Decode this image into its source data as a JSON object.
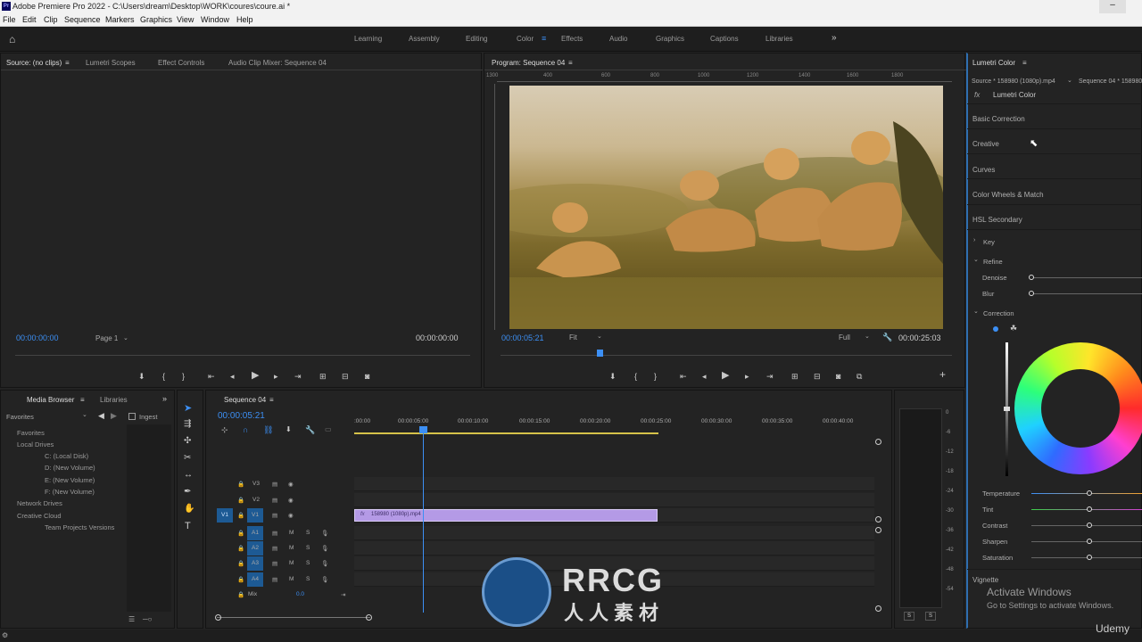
{
  "app": {
    "title": "Adobe Premiere Pro 2022 - C:\\Users\\dream\\Desktop\\WORK\\coures\\coure.ai *",
    "logo": "Pr"
  },
  "menu": [
    "File",
    "Edit",
    "Clip",
    "Sequence",
    "Markers",
    "Graphics",
    "View",
    "Window",
    "Help"
  ],
  "workspaces": [
    "Learning",
    "Assembly",
    "Editing",
    "Color",
    "Effects",
    "Audio",
    "Graphics",
    "Captions",
    "Libraries"
  ],
  "active_workspace": "Color",
  "source_panel": {
    "tabs": [
      "Source: (no clips)",
      "Lumetri Scopes",
      "Effect Controls",
      "Audio Clip Mixer: Sequence 04"
    ],
    "timecode_left": "00:00:00:00",
    "page": "Page 1",
    "timecode_right": "00:00:00:00"
  },
  "program_panel": {
    "title": "Program: Sequence 04",
    "ruler": [
      "1300",
      "400",
      "600",
      "800",
      "1000",
      "1200",
      "1400",
      "1600",
      "1800"
    ],
    "timecode": "00:00:05:21",
    "fit": "Fit",
    "quality": "Full",
    "duration": "00:00:25:03"
  },
  "lumetri": {
    "title": "Lumetri Color",
    "source": "Source * 158980 (1080p).mp4",
    "sequence": "Sequence 04 * 158980",
    "fx": "Lumetri Color",
    "sections": [
      "Basic Correction",
      "Creative",
      "Curves",
      "Color Wheels & Match",
      "HSL Secondary"
    ],
    "key": "Key",
    "refine": "Refine",
    "denoise": "Denoise",
    "blur": "Blur",
    "correction": "Correction",
    "sliders": [
      "Temperature",
      "Tint",
      "Contrast",
      "Sharpen",
      "Saturation"
    ],
    "vignette": "Vignette"
  },
  "media_browser": {
    "tabs": [
      "Media Browser",
      "Libraries"
    ],
    "favorites_dropdown": "Favorites",
    "ingest": "Ingest",
    "tree": [
      "Favorites",
      "Local Drives",
      "C: (Local Disk)",
      "D: (New Volume)",
      "E: (New Volume)",
      "F: (New Volume)",
      "Network Drives",
      "Creative Cloud",
      "Team Projects Versions"
    ]
  },
  "timeline": {
    "title": "Sequence 04",
    "timecode": "00:00:05:21",
    "ruler": [
      ":00:00",
      "00:00:05:00",
      "00:00:10:00",
      "00:00:15:00",
      "00:00:20:00",
      "00:00:25:00",
      "00:00:30:00",
      "00:00:35:00",
      "00:00:40:00"
    ],
    "video_tracks": [
      "V3",
      "V2",
      "V1"
    ],
    "audio_tracks": [
      "A1",
      "A2",
      "A3",
      "A4"
    ],
    "source_v1": "V1",
    "mix": "Mix",
    "mix_value": "0.0",
    "clip": "158980 (1080p).mp4",
    "m": "M",
    "s": "S"
  },
  "meter": {
    "labels": [
      "0",
      "-6",
      "-12",
      "-18",
      "-24",
      "-30",
      "-36",
      "-42",
      "-48",
      "-54"
    ],
    "solo": [
      "S",
      "S"
    ]
  },
  "watermark": {
    "activate": "Activate Windows",
    "goto": "Go to Settings to activate Windows.",
    "udemy": "Udemy",
    "rrcg": "RRCG",
    "rrcg_cn": "人人素材"
  },
  "colors": {
    "accent": "#3c8ff4",
    "clip": "#b49ae6",
    "track_active": "#1d5a94"
  }
}
